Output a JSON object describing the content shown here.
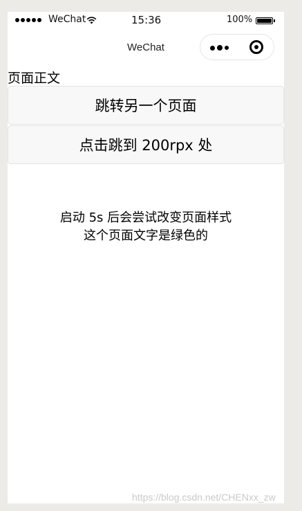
{
  "status_bar": {
    "carrier": "WeChat",
    "time": "15:36",
    "battery_percent": "100%"
  },
  "nav": {
    "title": "WeChat"
  },
  "page": {
    "body_label": "页面正文",
    "buttons": [
      {
        "label": "跳转另一个页面"
      },
      {
        "label": "点击跳到 200rpx 处"
      }
    ],
    "notice_lines": [
      "启动 5s 后会尝试改变页面样式",
      "这个页面文字是绿色的"
    ]
  },
  "watermark": "https://blog.csdn.net/CHENxx_zw"
}
